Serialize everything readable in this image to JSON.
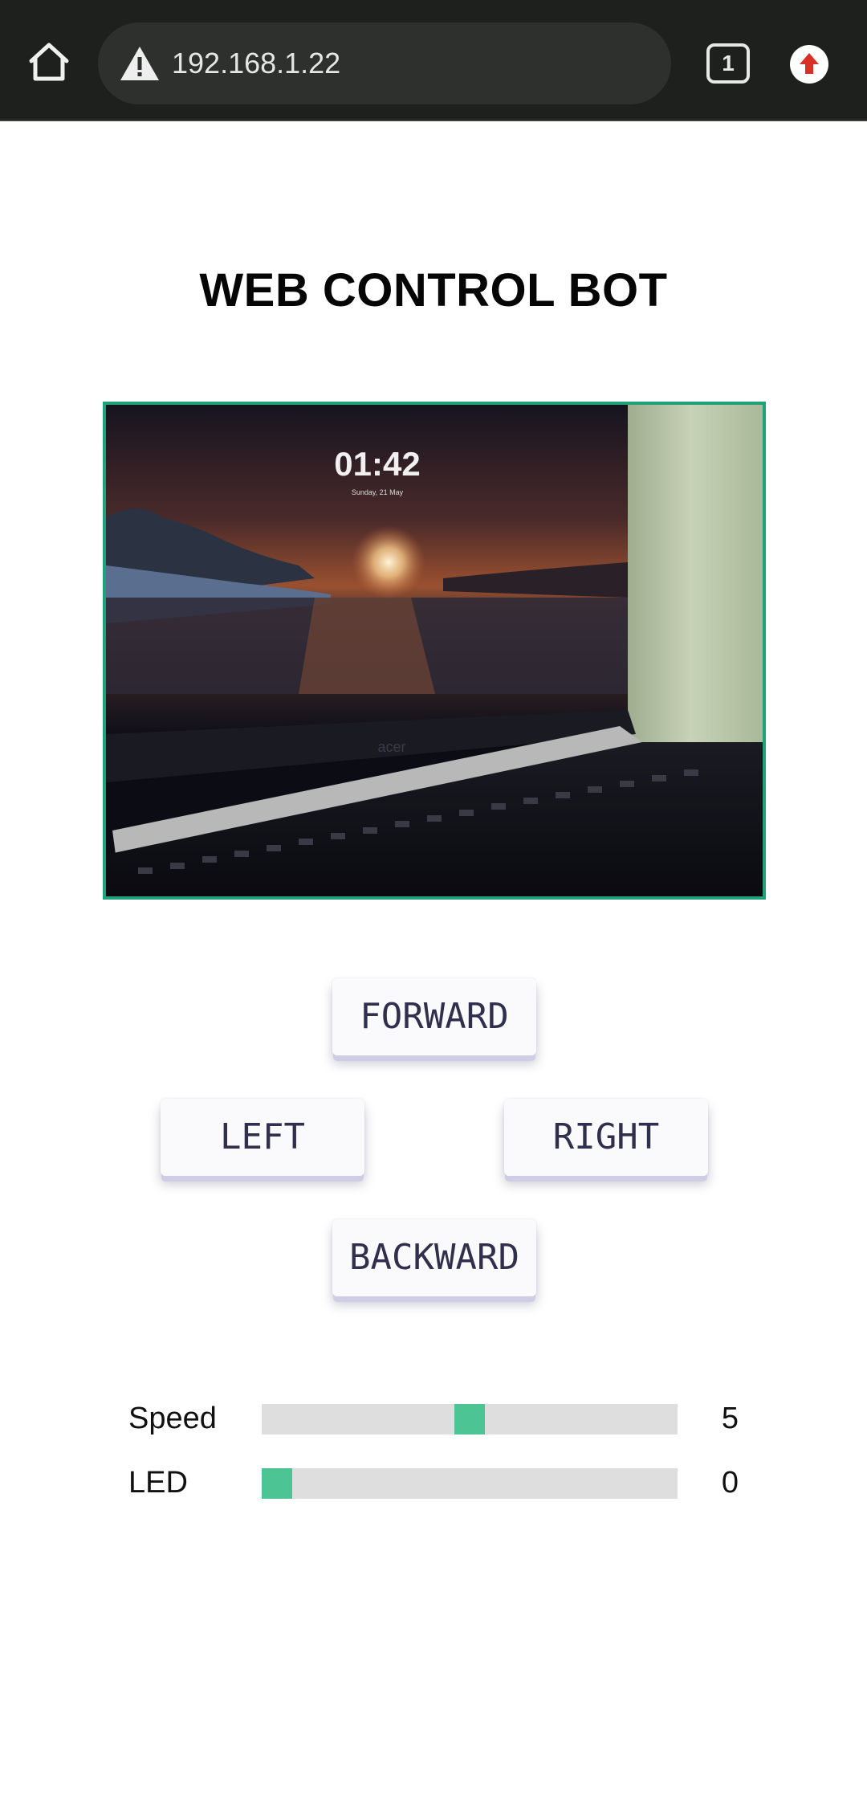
{
  "browser": {
    "url": "192.168.1.22",
    "tab_count": "1",
    "icons": [
      "home-icon",
      "warning-icon",
      "tabs-icon",
      "update-icon"
    ],
    "update_color": "#d93025"
  },
  "page": {
    "title": "WEB CONTROL BOT",
    "accent_color": "#1ea27a"
  },
  "camera": {
    "clock": "01:42",
    "date": "Sunday, 21 May",
    "laptop_brand": "acer"
  },
  "controls": {
    "forward": "FORWARD",
    "left": "LEFT",
    "right": "RIGHT",
    "backward": "BACKWARD"
  },
  "sliders": [
    {
      "label": "Speed",
      "value": "5",
      "min": 0,
      "max": 10
    },
    {
      "label": "LED",
      "value": "0",
      "min": 0,
      "max": 10
    }
  ],
  "slider_color": "#4cc493"
}
